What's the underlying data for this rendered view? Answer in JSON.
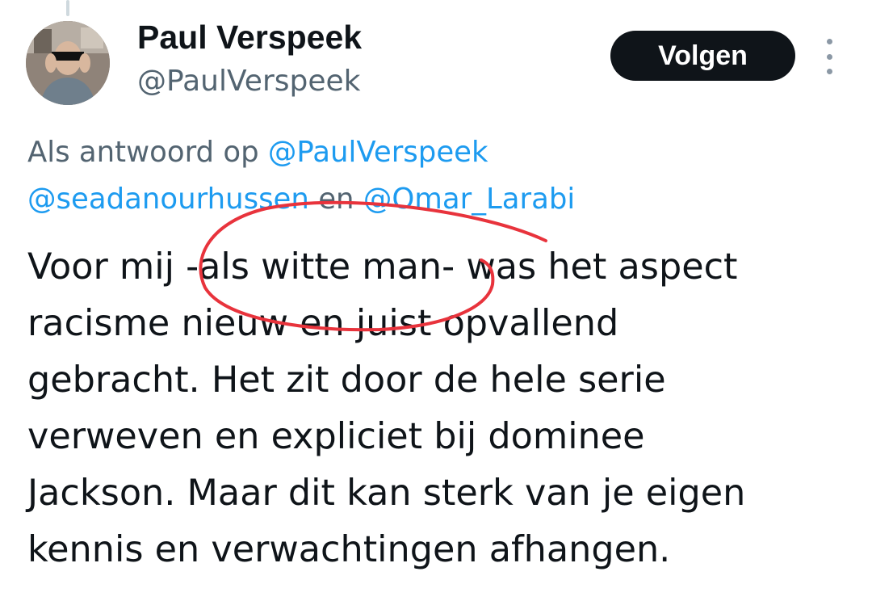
{
  "tweet": {
    "author": {
      "name": "Paul Verspeek",
      "handle": "@PaulVerspeek",
      "avatar_icon": "profile-photo-avatar"
    },
    "follow_label": "Volgen",
    "more_icon": "more-vertical-icon",
    "reply_context": {
      "prefix": "Als antwoord op ",
      "mention_1": "@PaulVerspeek",
      "mention_2": "@seadanourhussen",
      "connector": " en ",
      "mention_3": "@Omar_Larabi"
    },
    "text_lines": [
      "Voor mij -als witte man- was het aspect",
      "racisme nieuw en juist opvallend",
      "gebracht. Het zit door de hele serie",
      "verweven en expliciet bij dominee",
      "Jackson. Maar dit kan sterk van je eigen",
      "kennis en verwachtingen afhangen."
    ]
  },
  "colors": {
    "text": "#0f1419",
    "secondary": "#536471",
    "link": "#1d9bf0",
    "button_bg": "#0f1419",
    "annotation": "#e8333c"
  }
}
